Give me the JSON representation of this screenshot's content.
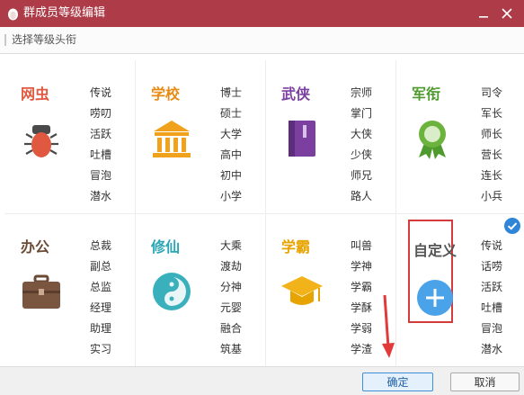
{
  "window": {
    "title": "群成员等级编辑",
    "icon": "penguin-icon",
    "minimize_icon": "minimize-icon",
    "close_icon": "close-icon"
  },
  "subheader": {
    "label": "选择等级头衔"
  },
  "categories": [
    {
      "name": "网虫",
      "color": "#e0583f",
      "icon": "bug-icon",
      "ranks": [
        "传说",
        "唠叨",
        "活跃",
        "吐槽",
        "冒泡",
        "潜水"
      ]
    },
    {
      "name": "学校",
      "color": "#e98a12",
      "icon": "school-building-icon",
      "ranks": [
        "博士",
        "硕士",
        "大学",
        "高中",
        "初中",
        "小学"
      ]
    },
    {
      "name": "武侠",
      "color": "#7b3fa0",
      "icon": "book-icon",
      "ranks": [
        "宗师",
        "掌门",
        "大侠",
        "少侠",
        "师兄",
        "路人"
      ]
    },
    {
      "name": "军衔",
      "color": "#4e9a2e",
      "icon": "medal-icon",
      "ranks": [
        "司令",
        "军长",
        "师长",
        "营长",
        "连长",
        "小兵"
      ]
    },
    {
      "name": "办公",
      "color": "#6b4a35",
      "icon": "briefcase-icon",
      "ranks": [
        "总裁",
        "副总",
        "总监",
        "经理",
        "助理",
        "实习"
      ]
    },
    {
      "name": "修仙",
      "color": "#2aa6b4",
      "icon": "yin-yang-icon",
      "ranks": [
        "大乘",
        "渡劫",
        "分神",
        "元婴",
        "融合",
        "筑基"
      ]
    },
    {
      "name": "学霸",
      "color": "#e7a400",
      "icon": "graduation-cap-icon",
      "ranks": [
        "叫兽",
        "学神",
        "学霸",
        "学酥",
        "学弱",
        "学渣"
      ]
    },
    {
      "name": "自定义",
      "color": "#555555",
      "icon": "add-icon",
      "selected": true,
      "ranks": [
        "传说",
        "话唠",
        "活跃",
        "吐槽",
        "冒泡",
        "潜水"
      ]
    }
  ],
  "footer": {
    "ok_label": "确定",
    "cancel_label": "取消"
  }
}
